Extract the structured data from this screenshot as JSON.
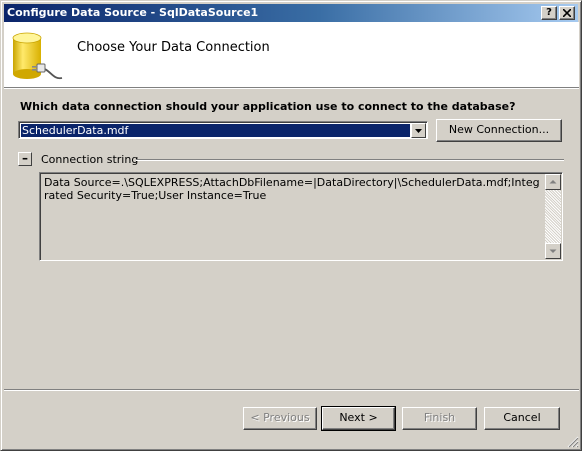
{
  "window": {
    "title": "Configure Data Source - SqlDataSource1",
    "help_label": "?",
    "close_label": "✕"
  },
  "header": {
    "title": "Choose Your Data Connection",
    "icon": "database-plug-icon"
  },
  "connection": {
    "question": "Which data connection should your application use to connect to the database?",
    "selected": "SchedulerData.mdf",
    "new_button_label": "New Connection..."
  },
  "connection_string": {
    "toggle_label": "–",
    "label": "Connection string",
    "value": "Data Source=.\\SQLEXPRESS;AttachDbFilename=|DataDirectory|\\SchedulerData.mdf;Integrated Security=True;User Instance=True"
  },
  "footer": {
    "previous_label": "< Previous",
    "next_label": "Next >",
    "finish_label": "Finish",
    "cancel_label": "Cancel"
  },
  "colors": {
    "title_active": "#0a246a",
    "selection": "#0a246a",
    "face": "#d4d0c8"
  }
}
